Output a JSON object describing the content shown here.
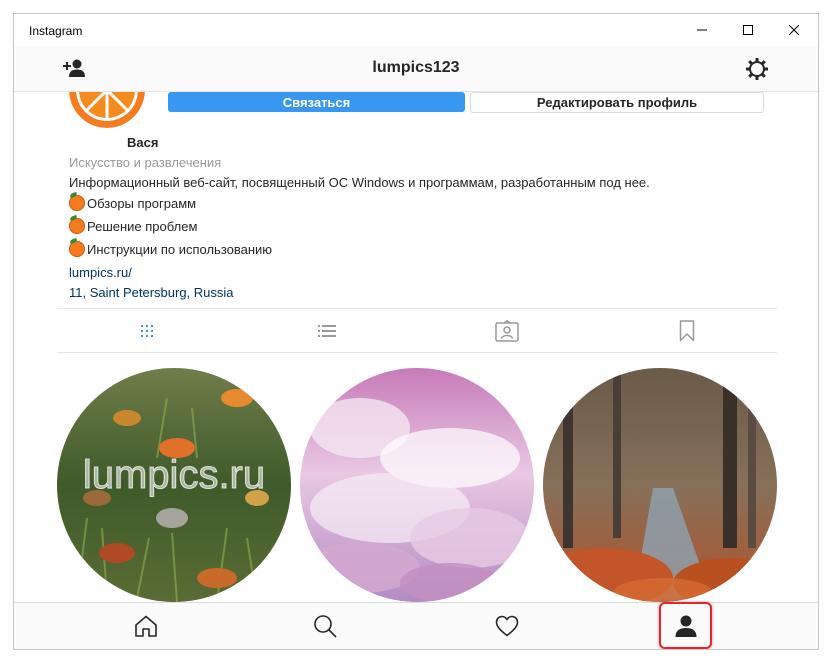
{
  "window": {
    "title": "Instagram"
  },
  "header": {
    "username": "lumpics123",
    "icons": {
      "left": "add-user-icon",
      "right": "gear-icon"
    }
  },
  "profile": {
    "contact_label": "Связаться",
    "edit_label": "Редактировать профиль",
    "full_name": "Вася",
    "category": "Искусство и развлечения",
    "bio": "Информационный веб-сайт, посвященный ОС Windows и программам, разработанным под нее.",
    "bio_items": [
      "Обзоры программ",
      "Решение проблем",
      "Инструкции по использованию"
    ],
    "website": "lumpics.ru/",
    "address": "11, Saint Petersburg, Russia"
  },
  "tabs": [
    {
      "icon": "grid-icon",
      "active": true
    },
    {
      "icon": "list-icon",
      "active": false
    },
    {
      "icon": "tagged-icon",
      "active": false
    },
    {
      "icon": "bookmark-icon",
      "active": false
    }
  ],
  "posts": [
    {
      "description": "autumn leaves on grass",
      "watermark": "lumpics.ru"
    },
    {
      "description": "pink clouds sky"
    },
    {
      "description": "autumn park path"
    }
  ],
  "bottom_nav": [
    {
      "icon": "home-icon"
    },
    {
      "icon": "search-icon"
    },
    {
      "icon": "heart-icon"
    },
    {
      "icon": "profile-icon",
      "highlighted": true
    }
  ],
  "colors": {
    "accent": "#3897f0",
    "highlight": "#e8232a",
    "link": "#003569"
  }
}
